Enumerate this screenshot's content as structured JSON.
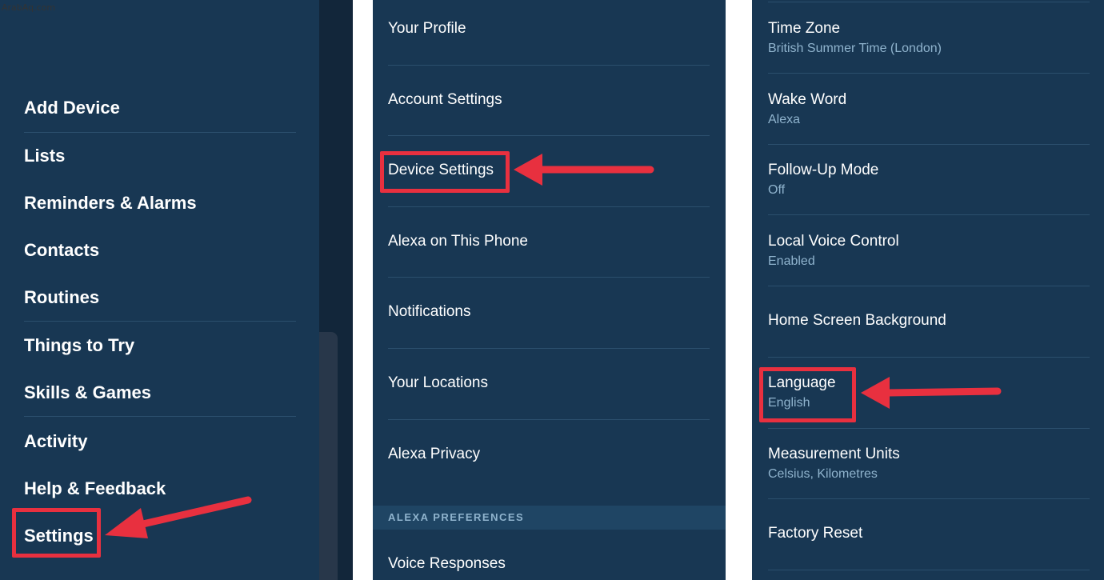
{
  "watermark": "ArabAq.com",
  "colors": {
    "panel_bg": "#183753",
    "divider": "#2b4f6d",
    "subtitle": "#8fb3cd",
    "highlight": "#e8303f"
  },
  "menu": {
    "items": [
      {
        "label": "Add Device"
      },
      {
        "label": "Lists"
      },
      {
        "label": "Reminders & Alarms"
      },
      {
        "label": "Contacts"
      },
      {
        "label": "Routines"
      },
      {
        "label": "Things to Try"
      },
      {
        "label": "Skills & Games"
      },
      {
        "label": "Activity"
      },
      {
        "label": "Help & Feedback"
      },
      {
        "label": "Settings",
        "highlighted": true
      }
    ]
  },
  "settings": {
    "items": [
      {
        "label": "Your Profile"
      },
      {
        "label": "Account Settings"
      },
      {
        "label": "Device Settings",
        "highlighted": true
      },
      {
        "label": "Alexa on This Phone"
      },
      {
        "label": "Notifications"
      },
      {
        "label": "Your Locations"
      },
      {
        "label": "Alexa Privacy"
      }
    ],
    "section_title": "ALEXA PREFERENCES",
    "section_items": [
      {
        "label": "Voice Responses"
      }
    ]
  },
  "device_settings": {
    "items": [
      {
        "label": "Time Zone",
        "value": "British Summer Time (London)"
      },
      {
        "label": "Wake Word",
        "value": "Alexa"
      },
      {
        "label": "Follow-Up Mode",
        "value": "Off"
      },
      {
        "label": "Local Voice Control",
        "value": "Enabled"
      },
      {
        "label": "Home Screen Background"
      },
      {
        "label": "Language",
        "value": "English",
        "highlighted": true
      },
      {
        "label": "Measurement Units",
        "value": "Celsius, Kilometres"
      },
      {
        "label": "Factory Reset"
      }
    ]
  }
}
